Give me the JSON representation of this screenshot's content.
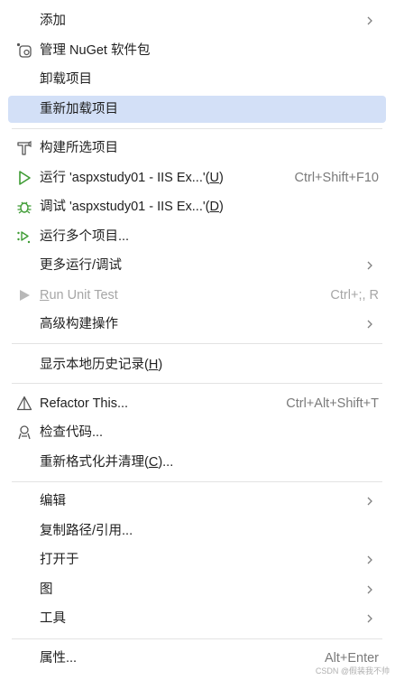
{
  "menu": {
    "items": [
      {
        "label": "添加",
        "shortcut": "",
        "submenu": true
      },
      {
        "label": "管理 NuGet 软件包",
        "icon": "nuget-icon"
      },
      {
        "label": "卸载项目"
      },
      {
        "label": "重新加载项目",
        "highlighted": true
      },
      {
        "label": "构建所选项目",
        "icon": "build-hammer-icon"
      },
      {
        "label_pre": "运行 'aspxstudy01 - IIS Ex...'(",
        "mnemonic": "U",
        "label_post": ")",
        "shortcut": "Ctrl+Shift+F10",
        "icon": "run-icon"
      },
      {
        "label_pre": "调试 'aspxstudy01 - IIS Ex...'(",
        "mnemonic": "D",
        "label_post": ")",
        "icon": "debug-bug-icon"
      },
      {
        "label": "运行多个项目...",
        "icon": "run-multiple-icon"
      },
      {
        "label": "更多运行/调试",
        "submenu": true
      },
      {
        "label_pre": "",
        "mnemonic": "R",
        "label_post": "un Unit Test",
        "shortcut": "Ctrl+;, R",
        "icon": "run-unit-test-icon",
        "disabled": true
      },
      {
        "label": "高级构建操作",
        "submenu": true
      },
      {
        "label_pre": "显示本地历史记录(",
        "mnemonic": "H",
        "label_post": ")"
      },
      {
        "label": "Refactor This...",
        "shortcut": "Ctrl+Alt+Shift+T",
        "icon": "refactor-icon"
      },
      {
        "label": "检查代码...",
        "icon": "inspect-code-icon"
      },
      {
        "label_pre": "重新格式化并清理(",
        "mnemonic": "C",
        "label_post": ")..."
      },
      {
        "label": "编辑",
        "submenu": true
      },
      {
        "label": "复制路径/引用..."
      },
      {
        "label": "打开于",
        "submenu": true
      },
      {
        "label": "图",
        "submenu": true
      },
      {
        "label": "工具",
        "submenu": true
      },
      {
        "label": "属性...",
        "shortcut": "Alt+Enter"
      }
    ]
  },
  "watermark": "CSDN @假装我不帅",
  "colors": {
    "highlight": "#d3e0f7",
    "run_green": "#3f9c35",
    "separator": "#e3e3e3"
  }
}
